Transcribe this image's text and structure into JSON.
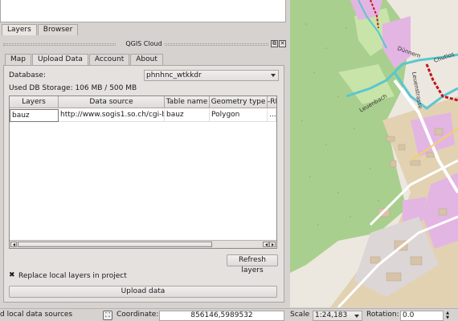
{
  "dock": {
    "tabs": [
      "Layers",
      "Browser"
    ],
    "title": "QGIS Cloud",
    "float_label": "⧉",
    "close_label": "✕"
  },
  "plugin": {
    "tabs": [
      "Map",
      "Upload Data",
      "Account",
      "About"
    ],
    "database_label": "Database:",
    "database_value": "phnhnc_wtkkdr",
    "storage_text": "Used DB Storage: 106 MB / 500 MB",
    "table": {
      "columns": [
        "Layers",
        "Data source",
        "Table name",
        "Geometry type",
        "-RI"
      ],
      "rows": [
        [
          "bauz",
          "http://www.sogis1.so.ch/cgi-b...",
          "bauz",
          "Polygon",
          "..."
        ]
      ]
    },
    "refresh_button": "Refresh layers",
    "replace_checkbox": "Replace local layers in project",
    "replace_checked": true,
    "upload_button": "Upload data"
  },
  "map": {
    "street_labels": [
      "Dünnern",
      "Chutlos",
      "Leuenstrasse",
      "Leuenbach"
    ],
    "colors": {
      "forest": "#a9cf8e",
      "residential": "#e2d2b2",
      "commercial": "#e3b5e3",
      "industrial": "#d9c8d8",
      "water": "#5bc6d0",
      "rail": "#c0141c"
    }
  },
  "statusbar": {
    "left_text": "d local data sources",
    "coordinate_label": "Coordinate:",
    "coordinate_value": "856146,5989532",
    "scale_label": "Scale",
    "scale_value": "1:24,183",
    "rotation_label": "Rotation:",
    "rotation_value": "0.0"
  }
}
